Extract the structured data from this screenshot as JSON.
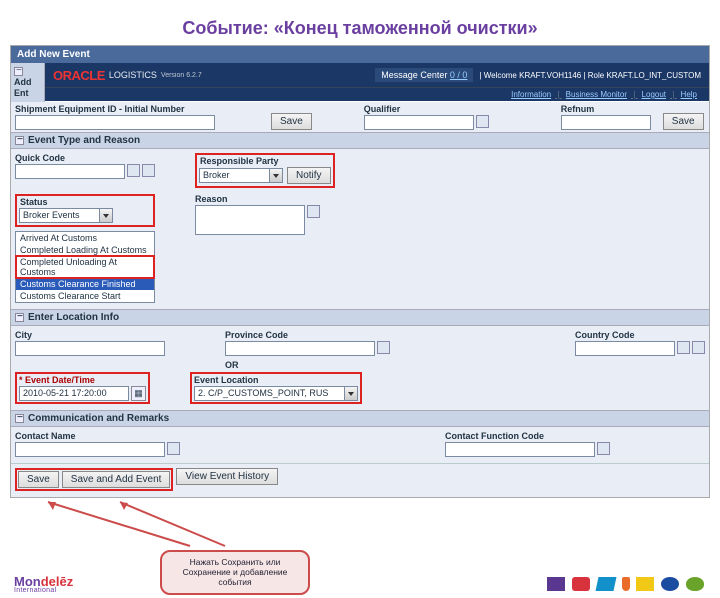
{
  "slideTitle": "Событие: «Конец таможенной очистки»",
  "addNewEvent": "Add New Event",
  "addEnt": "Add Ent",
  "oracle": {
    "brand1": "ORACLE",
    "brand2": "LOGISTICS",
    "version": "Version 6.2.7",
    "msgCenter": "Message Center",
    "msgCount": "0 / 0",
    "welcome": "Welcome",
    "user": "KRAFT.VOH1146",
    "roleLbl": "Role",
    "role": "KRAFT.LO_INT_CUSTOM",
    "links": {
      "info": "Information",
      "bm": "Business Monitor",
      "logout": "Logout",
      "help": "Help"
    }
  },
  "shipRow": {
    "label": "Shipment Equipment ID - Initial Number",
    "save": "Save",
    "qualifier": "Qualifier",
    "refnum": "Refnum"
  },
  "sections": {
    "evtType": "Event Type and Reason",
    "locInfo": "Enter Location Info",
    "comm": "Communication and Remarks"
  },
  "evt": {
    "quickCode": "Quick Code",
    "responsibleParty": "Responsible Party",
    "broker": "Broker",
    "notify": "Notify",
    "status": "Status",
    "statusVal": "Broker Events",
    "reason": "Reason",
    "opts": [
      "Arrived At Customs",
      "Completed Loading At Customs",
      "Completed Unloading At Customs",
      "Customs Clearance Finished",
      "Customs Clearance Start"
    ]
  },
  "loc": {
    "city": "City",
    "prov": "Province Code",
    "country": "Country Code",
    "or": "OR",
    "edt": "Event Date/Time",
    "edtVal": "2010-05-21 17:20:00",
    "eloc": "Event Location",
    "elocVal": "2. C/P_CUSTOMS_POINT, RUS"
  },
  "comm": {
    "contactName": "Contact Name",
    "contactFunc": "Contact Function Code"
  },
  "buttons": {
    "save": "Save",
    "saveAdd": "Save and Add Event",
    "history": "View Event History"
  },
  "callout": "Нажать Сохранить или Сохранение и добавление события",
  "brand": {
    "m": "Mondelez",
    "sub": "International"
  }
}
